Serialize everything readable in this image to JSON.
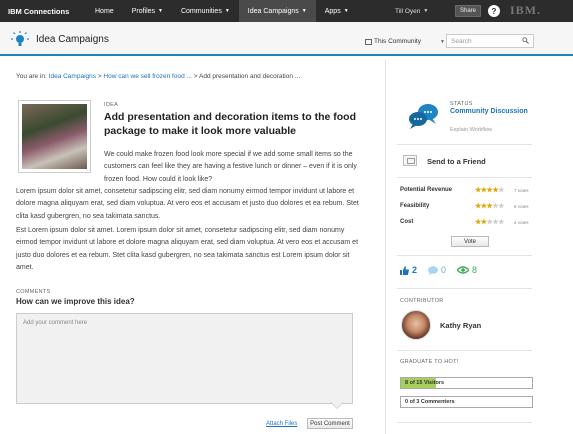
{
  "nav": {
    "brand": "IBM Connections",
    "items": [
      {
        "label": "Home",
        "dropdown": false
      },
      {
        "label": "Profiles",
        "dropdown": true
      },
      {
        "label": "Communities",
        "dropdown": true
      },
      {
        "label": "Idea Campaigns",
        "dropdown": true,
        "active": true
      },
      {
        "label": "Apps",
        "dropdown": true
      }
    ],
    "user": "Till Oyen",
    "share": "Share",
    "help": "?",
    "logo": "IBM."
  },
  "header": {
    "app_name": "Idea Campaigns",
    "scope": "This Community",
    "search_placeholder": "Search"
  },
  "breadcrumb": {
    "prefix": "You are in:",
    "link1": "Idea Campaigns",
    "sep1": ">",
    "link2": "How can we sell frozen food ...",
    "sep2": ">",
    "current": "Add presentation and decoration ..."
  },
  "idea": {
    "label": "IDEA",
    "title": "Add presentation and decoration items to the food package to make it look more valuable",
    "p1": "We could make frozen food look more special if we add some small items so the customers can feel like they are having a festive lunch or dinner – even if it is only frozen food. How could it look like?",
    "p2": "Lorem ipsum dolor sit amet, consetetur sadipscing elitr, sed diam nonumy eirmod tempor invidunt ut labore et dolore magna aliquyam erat, sed diam voluptua. At vero eos et accusam et justo duo dolores et ea rebum. Stet clita kasd gubergren, no sea takimata sanctus.",
    "p3": "Est Lorem ipsum dolor sit amet. Lorem ipsum dolor sit amet, consetetur sadipscing elitr, sed diam nonumy eirmod tempor invidunt ut labore et dolore magna aliquyam erat, sed diam voluptua. At vero eos et accusam et justo duo dolores et ea rebum. Stet clita kasd gubergren, no sea takimata sanctus est Lorem ipsum dolor sit amet."
  },
  "comments": {
    "label": "COMMENTS",
    "question": "How can we improve this idea?",
    "placeholder": "Add your comment here",
    "attach": "Attach Files",
    "post": "Post Comment"
  },
  "status": {
    "label": "STATUS",
    "value": "Community Discussion",
    "workflow": "Explain Workflow"
  },
  "send": "Send to a Friend",
  "ratings": [
    {
      "label": "Potential Revenue",
      "stars": 4,
      "max": 5,
      "votes": "7 votes"
    },
    {
      "label": "Feasibility",
      "stars": 3,
      "max": 5,
      "votes": "8 votes"
    },
    {
      "label": "Cost",
      "stars": 2,
      "max": 5,
      "votes": "4 votes"
    }
  ],
  "vote_label": "Vote",
  "counts": {
    "likes": "2",
    "comments": "0",
    "views": "8"
  },
  "contributor": {
    "label": "CONTRIBUTOR",
    "name": "Kathy Ryan"
  },
  "graduate": {
    "label": "GRADUATE TO HOT!",
    "visitors": {
      "text": "8 of 15 Visitors",
      "fraction": 0.533
    },
    "commenters": {
      "text": "0 of 3 Commenters",
      "fraction": 0
    }
  },
  "colors": {
    "accent": "#1e84c2",
    "link": "#1e73be",
    "star": "#e0a400",
    "progress": "#a6cf5c"
  }
}
